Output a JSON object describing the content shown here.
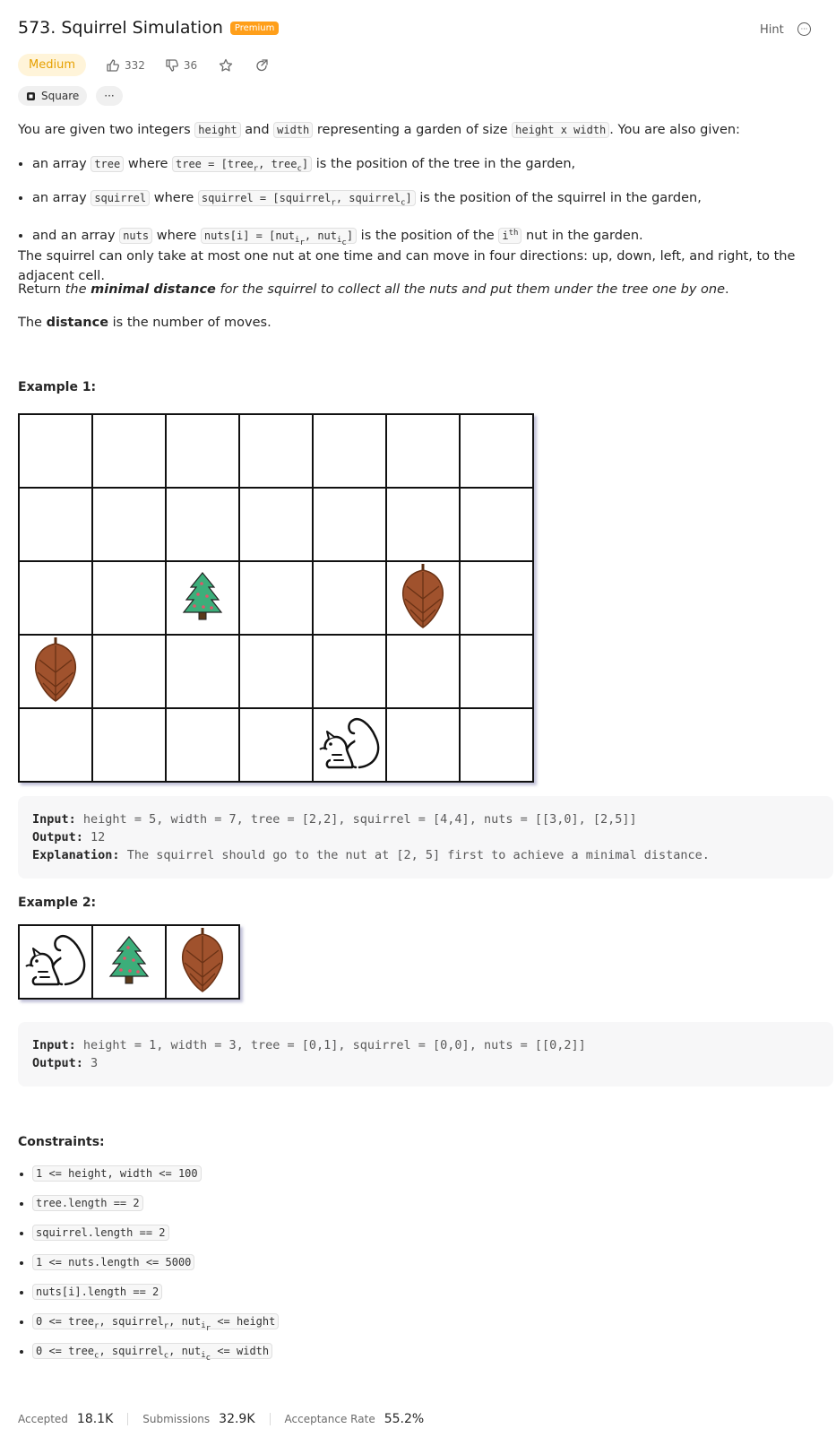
{
  "problem": {
    "title": "573. Squirrel Simulation",
    "premium_label": "Premium",
    "hint_label": "Hint"
  },
  "meta": {
    "difficulty": "Medium",
    "likes": "332",
    "dislikes": "36"
  },
  "tags": [
    {
      "label": "Square"
    },
    {
      "label": "···"
    }
  ],
  "description": {
    "intro": {
      "t1": "You are given two integers ",
      "c1": "height",
      "t2": " and ",
      "c2": "width",
      "t3": " representing a garden of size ",
      "c3": "height x width",
      "t4": ". You are also given:"
    },
    "b1": {
      "t1": "an array ",
      "c1": "tree",
      "t2": " where ",
      "c2a": "tree = [tree",
      "sub1": "r",
      "c2b": ", tree",
      "sub2": "c",
      "c2c": "]",
      "t3": " is the position of the tree in the garden,"
    },
    "b2": {
      "t1": "an array ",
      "c1": "squirrel",
      "t2": " where ",
      "c2a": "squirrel = [squirrel",
      "sub1": "r",
      "c2b": ", squirrel",
      "sub2": "c",
      "c2c": "]",
      "t3": " is the position of the squirrel in the garden,"
    },
    "b3": {
      "t1": "and an array ",
      "c1": "nuts",
      "t2": " where ",
      "c2a": "nuts[i] = [nut",
      "sub1a": "i",
      "sub1b": "r",
      "c2b": ", nut",
      "sub2a": "i",
      "sub2b": "c",
      "c2c": "]",
      "t3": " is the position of the ",
      "c3": "i",
      "sup3": "th",
      "t4": " nut in the garden."
    },
    "p2": "The squirrel can only take at most one nut at one time and can move in four directions: up, down, left, and right, to the adjacent cell.",
    "p3": {
      "t1": "Return ",
      "i1": "the ",
      "b1": "minimal distance",
      "i2": " for the squirrel to collect all the nuts and put them under the tree one by one",
      "t2": "."
    },
    "p4": {
      "t1": "The ",
      "b1": "distance",
      "t2": " is the number of moves."
    }
  },
  "example1": {
    "heading": "Example 1:",
    "grid_rows": 5,
    "grid_cols": 7,
    "tree_cell": [
      2,
      2
    ],
    "squirrel_cell": [
      4,
      4
    ],
    "nut_cells": [
      [
        3,
        0
      ],
      [
        2,
        5
      ]
    ],
    "input_label": "Input:",
    "input": "height = 5, width = 7, tree = [2,2], squirrel = [4,4], nuts = [[3,0], [2,5]]",
    "output_label": "Output:",
    "output": "12",
    "explanation_label": "Explanation:",
    "explanation": "The squirrel should go to the nut at [2, 5] first to achieve a minimal distance."
  },
  "example2": {
    "heading": "Example 2:",
    "grid_rows": 1,
    "grid_cols": 3,
    "tree_cell": [
      0,
      1
    ],
    "squirrel_cell": [
      0,
      0
    ],
    "nut_cells": [
      [
        0,
        2
      ]
    ],
    "input_label": "Input:",
    "input": "height = 1, width = 3, tree = [0,1], squirrel = [0,0], nuts = [[0,2]]",
    "output_label": "Output:",
    "output": "3"
  },
  "constraints": {
    "heading": "Constraints:",
    "c1": "1 <= height, width <= 100",
    "c2": "tree.length == 2",
    "c3": "squirrel.length == 2",
    "c4": "1 <= nuts.length <= 5000",
    "c5": "nuts[i].length == 2",
    "c6": {
      "a": "0 <= tree",
      "s1": "r",
      "b": ", squirrel",
      "s2": "r",
      "c": ", nut",
      "s3a": "i",
      "s3b": "r",
      "d": " <= height"
    },
    "c7": {
      "a": "0 <= tree",
      "s1": "c",
      "b": ", squirrel",
      "s2": "c",
      "c": ", nut",
      "s3a": "i",
      "s3b": "c",
      "d": " <= width"
    }
  },
  "stats": {
    "accepted_label": "Accepted",
    "accepted": "18.1K",
    "submissions_label": "Submissions",
    "submissions": "32.9K",
    "rate_label": "Acceptance Rate",
    "rate": "55.2%"
  },
  "colors": {
    "premium": "#ff9f1a",
    "difficulty_text": "#e6a000",
    "difficulty_bg": "#fff4d9",
    "tree": "#3cae7a",
    "nut": "#a0522d"
  }
}
